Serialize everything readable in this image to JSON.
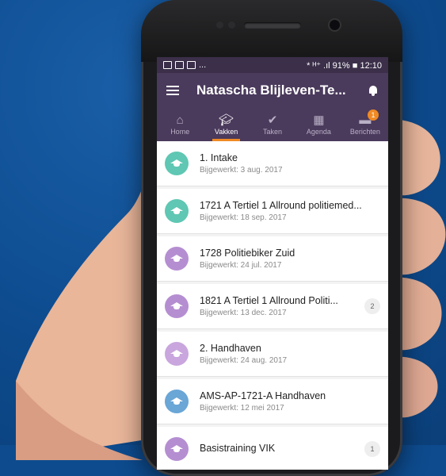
{
  "colors": {
    "background": "#0d4b8e",
    "appbar": "#4a3a5c",
    "accent": "#f08a24",
    "teal": "#5fc7b3",
    "purple": "#b58ed1",
    "blue": "#6aa6d6"
  },
  "statusbar": {
    "left_icons": [
      "image-icon",
      "wifi-icon",
      "notification-icon"
    ],
    "left_text": "...",
    "battery": "91%",
    "time": "12:10",
    "signal_text": "* ᴴ⁺ .ıl"
  },
  "appbar": {
    "title": "Natascha Blijleven-Te..."
  },
  "tabs": [
    {
      "label": "Home",
      "icon": "home-icon"
    },
    {
      "label": "Vakken",
      "icon": "graduation-cap-icon",
      "active": true
    },
    {
      "label": "Taken",
      "icon": "checkmark-icon"
    },
    {
      "label": "Agenda",
      "icon": "calendar-icon"
    },
    {
      "label": "Berichten",
      "icon": "chat-icon",
      "badge": "1"
    }
  ],
  "items": [
    {
      "title": "1. Intake",
      "subtitle": "Bijgewerkt: 3 aug. 2017",
      "color": "#5fc7b3",
      "count": ""
    },
    {
      "title": "1721 A Tertiel 1 Allround politiemed...",
      "subtitle": "Bijgewerkt: 18 sep. 2017",
      "color": "#5fc7b3",
      "count": ""
    },
    {
      "title": "1728 Politiebiker Zuid",
      "subtitle": "Bijgewerkt: 24 jul. 2017",
      "color": "#b58ed1",
      "count": ""
    },
    {
      "title": "1821 A Tertiel 1 Allround Politi...",
      "subtitle": "Bijgewerkt: 13 dec. 2017",
      "color": "#b58ed1",
      "count": "2"
    },
    {
      "title": "2. Handhaven",
      "subtitle": "Bijgewerkt: 24 aug. 2017",
      "color": "#c9a6dd",
      "count": ""
    },
    {
      "title": "AMS-AP-1721-A Handhaven",
      "subtitle": "Bijgewerkt: 12 mei 2017",
      "color": "#6aa6d6",
      "count": ""
    },
    {
      "title": "Basistraining VIK",
      "subtitle": "",
      "color": "#b58ed1",
      "count": "1"
    }
  ]
}
